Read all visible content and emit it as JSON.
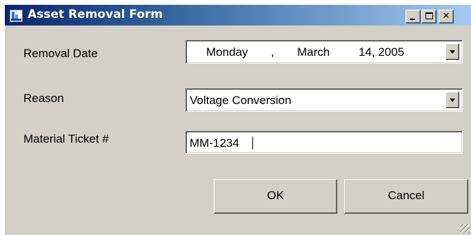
{
  "window": {
    "title": "Asset Removal Form",
    "icons": {
      "app": "asset-app-icon",
      "minimize": "minimize-icon",
      "maximize": "maximize-icon",
      "close": "close-icon"
    }
  },
  "form": {
    "removal_date": {
      "label": "Removal Date",
      "weekday": "Monday",
      "separator": ",",
      "month": "March",
      "day_year": "14, 2005"
    },
    "reason": {
      "label": "Reason",
      "value": "Voltage Conversion"
    },
    "material_ticket": {
      "label": "Material Ticket #",
      "value": "MM-1234"
    }
  },
  "buttons": {
    "ok": "OK",
    "cancel": "Cancel"
  },
  "colors": {
    "face": "#d4d0c8",
    "title_start": "#0a246a",
    "title_end": "#a6caf0"
  }
}
